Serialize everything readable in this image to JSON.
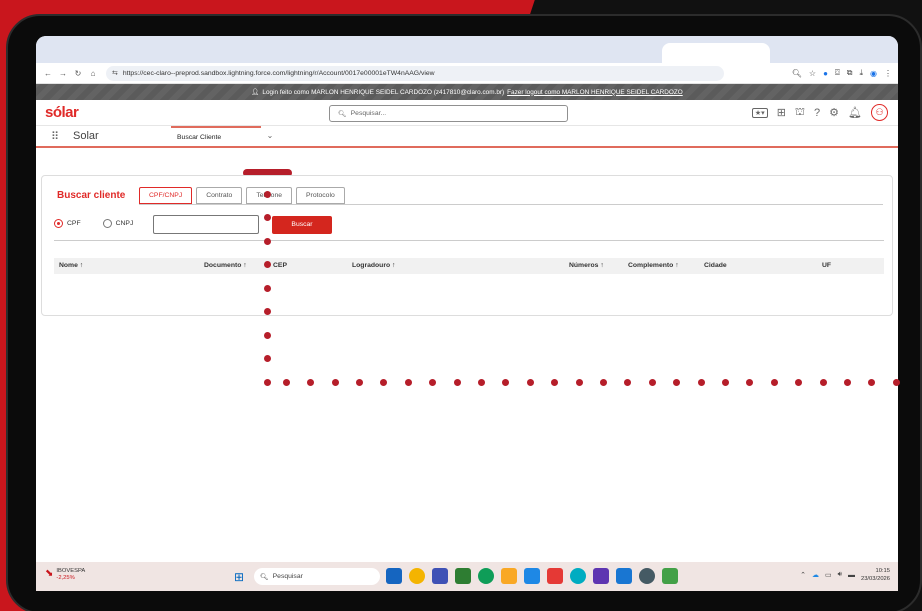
{
  "browser": {
    "url": "https://cec-claro--preprod.sandbox.lightning.force.com/lightning/r/Account/0017e00001eTW4nAAG/view",
    "nav_icons": [
      "back-icon",
      "forward-icon",
      "reload-icon",
      "home-icon"
    ]
  },
  "impersonation": {
    "text": "Login feito como MARLON HENRIQUE SEIDEL CARDOZO (z417810@claro.com.br)",
    "logout_link": "Fazer logout como MARLON HENRIQUE SEIDEL CARDOZO"
  },
  "header": {
    "logo": "sólar",
    "search_placeholder": "Pesquisar..."
  },
  "appnav": {
    "app_name": "Solar",
    "tab_label": "Buscar Cliente"
  },
  "panel": {
    "title": "Buscar cliente",
    "tabs": [
      {
        "label": "CPF/CNPJ",
        "active": true
      },
      {
        "label": "Contrato",
        "active": false
      },
      {
        "label": "Telefone",
        "active": false
      },
      {
        "label": "Protocolo",
        "active": false
      }
    ],
    "radios": [
      {
        "label": "CPF",
        "checked": true
      },
      {
        "label": "CNPJ",
        "checked": false
      }
    ],
    "input_value": "",
    "search_button": "Buscar",
    "columns": [
      "Nome ↑",
      "Documento ↑",
      "CEP",
      "Logradouro ↑",
      "Números ↑",
      "Complemento ↑",
      "Cidade",
      "UF"
    ]
  },
  "taskbar": {
    "ticker_name": "IBOVESPA",
    "ticker_change": "-2,25%",
    "search_placeholder": "Pesquisar",
    "time": "10:15",
    "date": "23/03/2026"
  },
  "colors": {
    "brand_red": "#e02a28",
    "accent_dark_red": "#b61e2a",
    "background_red": "#c9161d"
  }
}
